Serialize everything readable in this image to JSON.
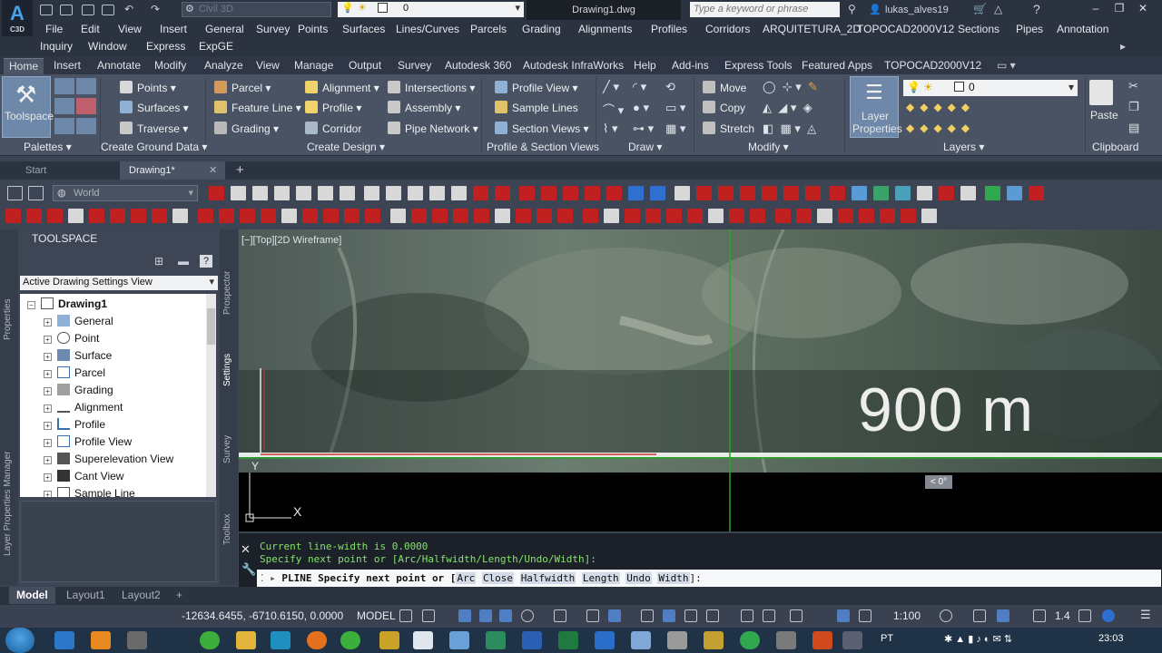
{
  "titlebar": {
    "workspace": "Civil 3D",
    "layer": "0",
    "document": "Drawing1.dwg",
    "search_placeholder": "Type a keyword or phrase",
    "user": "lukas_alves19",
    "app_abbr": "A",
    "app_sub": "C3D"
  },
  "menus": {
    "row1": [
      "File",
      "Edit",
      "View",
      "Insert",
      "General",
      "Survey",
      "Points",
      "Surfaces",
      "Lines/Curves",
      "Parcels",
      "Grading",
      "Alignments",
      "Profiles",
      "Corridors",
      "ARQUITETURA_2D",
      "TOPOCAD2000V12",
      "Sections",
      "Pipes",
      "Annotation"
    ],
    "row2": [
      "Inquiry",
      "Window",
      "Express",
      "ExpGE"
    ]
  },
  "ribbon_tabs": [
    "Home",
    "Insert",
    "Annotate",
    "Modify",
    "Analyze",
    "View",
    "Manage",
    "Output",
    "Survey",
    "Autodesk 360",
    "Autodesk InfraWorks",
    "Help",
    "Add-ins",
    "Express Tools",
    "Featured Apps",
    "TOPOCAD2000V12"
  ],
  "ribbon": {
    "toolspace": "Toolspace",
    "points": "Points",
    "surfaces": "Surfaces",
    "traverse": "Traverse",
    "parcel": "Parcel",
    "feature_line": "Feature Line",
    "grading": "Grading",
    "alignment": "Alignment",
    "profile": "Profile",
    "corridor": "Corridor",
    "intersections": "Intersections",
    "assembly": "Assembly",
    "pipe_network": "Pipe Network",
    "profile_view": "Profile View",
    "sample_lines": "Sample Lines",
    "section_views": "Section Views",
    "move": "Move",
    "copy": "Copy",
    "stretch": "Stretch",
    "layer_properties_1": "Layer",
    "layer_properties_2": "Properties",
    "layer_combo": "0",
    "paste": "Paste",
    "panels": {
      "palettes": "Palettes",
      "ground": "Create Ground Data",
      "design": "Create Design",
      "profile_section": "Profile & Section Views",
      "draw": "Draw",
      "modify": "Modify",
      "layers": "Layers",
      "clipboard": "Clipboard"
    }
  },
  "doc_tabs": {
    "start": "Start",
    "drawing": "Drawing1*"
  },
  "toolbar": {
    "ucs": "World"
  },
  "toolspace": {
    "title": "TOOLSPACE",
    "view_select": "Active Drawing Settings View",
    "side_tabs": [
      "Prospector",
      "Settings",
      "Survey",
      "Toolbox"
    ],
    "left_tabs": [
      "Properties",
      "Layer Properties Manager"
    ],
    "tree_root": "Drawing1",
    "tree_items": [
      "General",
      "Point",
      "Surface",
      "Parcel",
      "Grading",
      "Alignment",
      "Profile",
      "Profile View",
      "Superelevation View",
      "Cant View",
      "Sample Line"
    ]
  },
  "viewport": {
    "label": "[−][Top][2D Wireframe]",
    "scale_text": "900 m",
    "angle_tip": "< 0°",
    "ucs_y": "Y",
    "ucs_x": "X"
  },
  "command": {
    "history1": "Current line-width is 0.0000",
    "history2": "Specify next point or [Arc/Halfwidth/Length/Undo/Width]:",
    "prompt_prefix": "PLINE Specify next point or [",
    "options": [
      "Arc",
      "Close",
      "Halfwidth",
      "Length",
      "Undo",
      "Width"
    ],
    "prompt_suffix": "]:"
  },
  "layout_tabs": [
    "Model",
    "Layout1",
    "Layout2"
  ],
  "statusbar": {
    "coords": "-12634.6455, -6710.6150, 0.0000",
    "model": "MODEL",
    "scale": "1:100",
    "zoom": "1.4"
  },
  "taskbar": {
    "lang": "PT",
    "clock": "23:03"
  },
  "colors": {
    "accent": "#6d88a8",
    "command_text": "#86e26d",
    "ucs_red": "#e03030",
    "crosshair_green": "#22aa22"
  }
}
